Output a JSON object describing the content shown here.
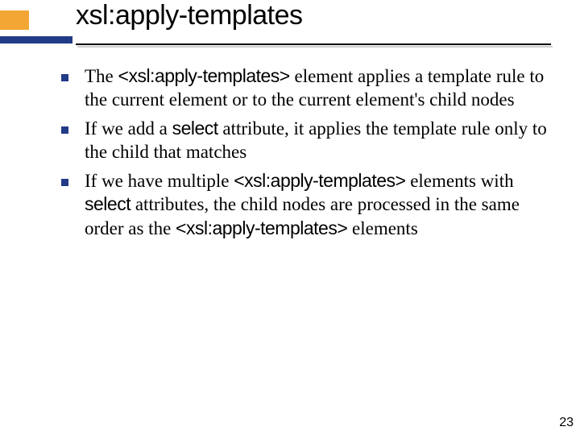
{
  "title": "xsl:apply-templates",
  "bullets": [
    {
      "pre": "The ",
      "code1": "<xsl:apply-templates>",
      "mid1": " element applies a template rule to the current element or to the current element's child nodes"
    },
    {
      "pre": "If we add a ",
      "code1": "select",
      "mid1": " attribute, it applies the template rule only to the child that matches"
    },
    {
      "pre": "If we have multiple ",
      "code1": "<xsl:apply-templates>",
      "mid1": " elements with ",
      "code2": "select",
      "mid2": " attributes, the child nodes are processed in the same order as the ",
      "code3": "<xsl:apply-templates>",
      "mid3": " elements"
    }
  ],
  "page": "23"
}
